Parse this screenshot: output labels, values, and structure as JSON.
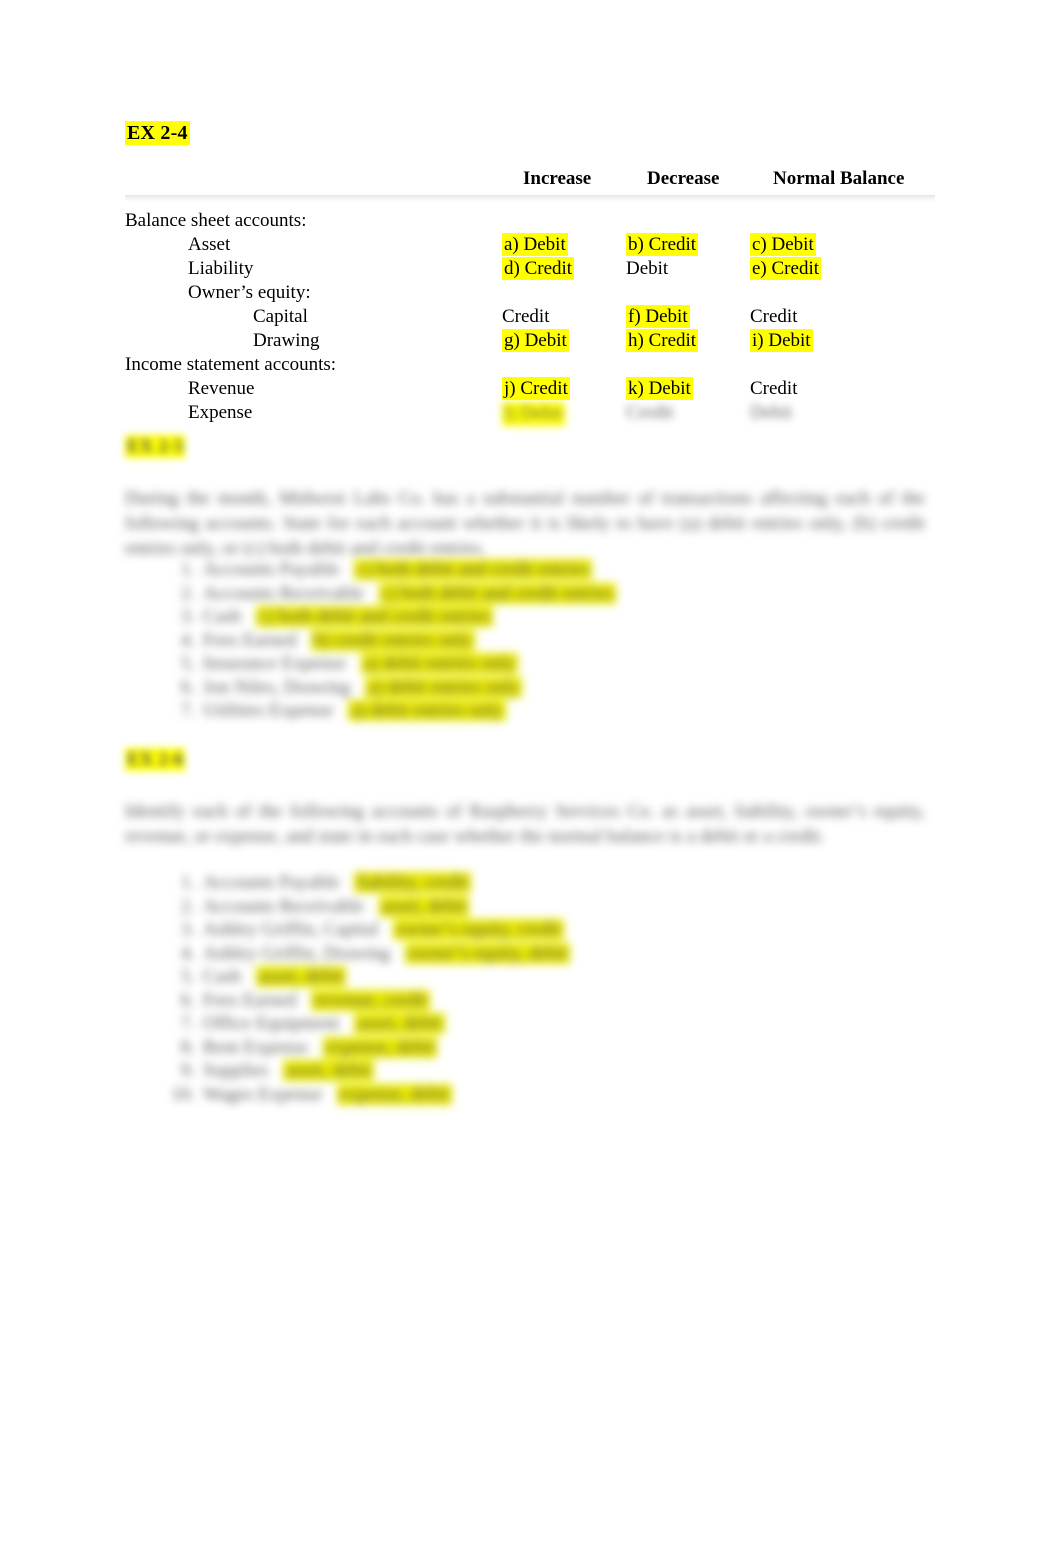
{
  "document": {
    "title": "EX 2-4",
    "title_highlighted": true
  },
  "table": {
    "headers": {
      "row_label": "",
      "increase": "Increase",
      "decrease": "Decrease",
      "normal_balance": "Normal Balance"
    },
    "rows": [
      {
        "label": "Balance sheet accounts:",
        "indent": 0,
        "increase": "",
        "decrease": "",
        "normal_balance": ""
      },
      {
        "label": "Asset",
        "indent": 1,
        "increase": "a) Debit",
        "decrease": "b) Credit",
        "normal_balance": "c) Debit"
      },
      {
        "label": "Liability",
        "indent": 1,
        "increase": "d) Credit",
        "decrease": "Debit",
        "normal_balance": "e) Credit"
      },
      {
        "label": "Owner’s equity:",
        "indent": 1,
        "increase": "",
        "decrease": "",
        "normal_balance": ""
      },
      {
        "label": "Capital",
        "indent": 2,
        "increase": "Credit",
        "decrease": "f) Debit",
        "normal_balance": "Credit"
      },
      {
        "label": "Drawing",
        "indent": 2,
        "increase": "g) Debit",
        "decrease": "h) Credit",
        "normal_balance": "i) Debit"
      },
      {
        "label": "Income statement accounts:",
        "indent": 0,
        "increase": "",
        "decrease": "",
        "normal_balance": ""
      },
      {
        "label": "Revenue",
        "indent": 1,
        "increase": "j) Credit",
        "decrease": "k) Debit",
        "normal_balance": "Credit"
      },
      {
        "label": "Expense",
        "indent": 1,
        "increase": "l) Debit",
        "decrease": "Credit",
        "normal_balance": "Debit"
      }
    ]
  },
  "section_two": {
    "tag": "EX 2-5",
    "paragraph": "During the month, Midwest Labs Co. has a substantial number of transactions affecting each of the following accounts. State for each account whether it is likely to have (a) debit entries only, (b) credit entries only, or (c) both debit and credit entries.",
    "items": [
      {
        "marker": "1.",
        "account": "Accounts Payable",
        "answer": "c) both debit and credit entries"
      },
      {
        "marker": "2.",
        "account": "Accounts Receivable",
        "answer": "c) both debit and credit entries"
      },
      {
        "marker": "3.",
        "account": "Cash",
        "answer": "c) both debit and credit entries"
      },
      {
        "marker": "4.",
        "account": "Fees Earned",
        "answer": "b) credit entries only"
      },
      {
        "marker": "5.",
        "account": "Insurance Expense",
        "answer": "a) debit entries only"
      },
      {
        "marker": "6.",
        "account": "Jon Niles, Drawing",
        "answer": "a) debit entries only"
      },
      {
        "marker": "7.",
        "account": "Utilities Expense",
        "answer": "a) debit entries only"
      }
    ]
  },
  "section_three": {
    "tag": "EX 2-6",
    "paragraph": "Identify each of the following accounts of Raspberry Services Co. as asset, liability, owner’s equity, revenue, or expense, and state in each case whether the normal balance is a debit or a credit.",
    "items": [
      {
        "marker": "1.",
        "account": "Accounts Payable",
        "answer": "liability, credit"
      },
      {
        "marker": "2.",
        "account": "Accounts Receivable",
        "answer": "asset, debit"
      },
      {
        "marker": "3.",
        "account": "Ashley Griffin, Capital",
        "answer": "owner’s equity, credit"
      },
      {
        "marker": "4.",
        "account": "Ashley Griffin, Drawing",
        "answer": "owner’s equity, debit"
      },
      {
        "marker": "5.",
        "account": "Cash",
        "answer": "asset, debit"
      },
      {
        "marker": "6.",
        "account": "Fees Earned",
        "answer": "revenue, credit"
      },
      {
        "marker": "7.",
        "account": "Office Equipment",
        "answer": "asset, debit"
      },
      {
        "marker": "8.",
        "account": "Rent Expense",
        "answer": "expense, debit"
      },
      {
        "marker": "9.",
        "account": "Supplies",
        "answer": "asset, debit"
      },
      {
        "marker": "10.",
        "account": "Wages Expense",
        "answer": "expense, debit"
      }
    ]
  },
  "colors": {
    "highlight": "#FFFF00",
    "highlight_muted": "#EAEA00",
    "text": "#000000",
    "page_background": "#FFFFFF"
  }
}
